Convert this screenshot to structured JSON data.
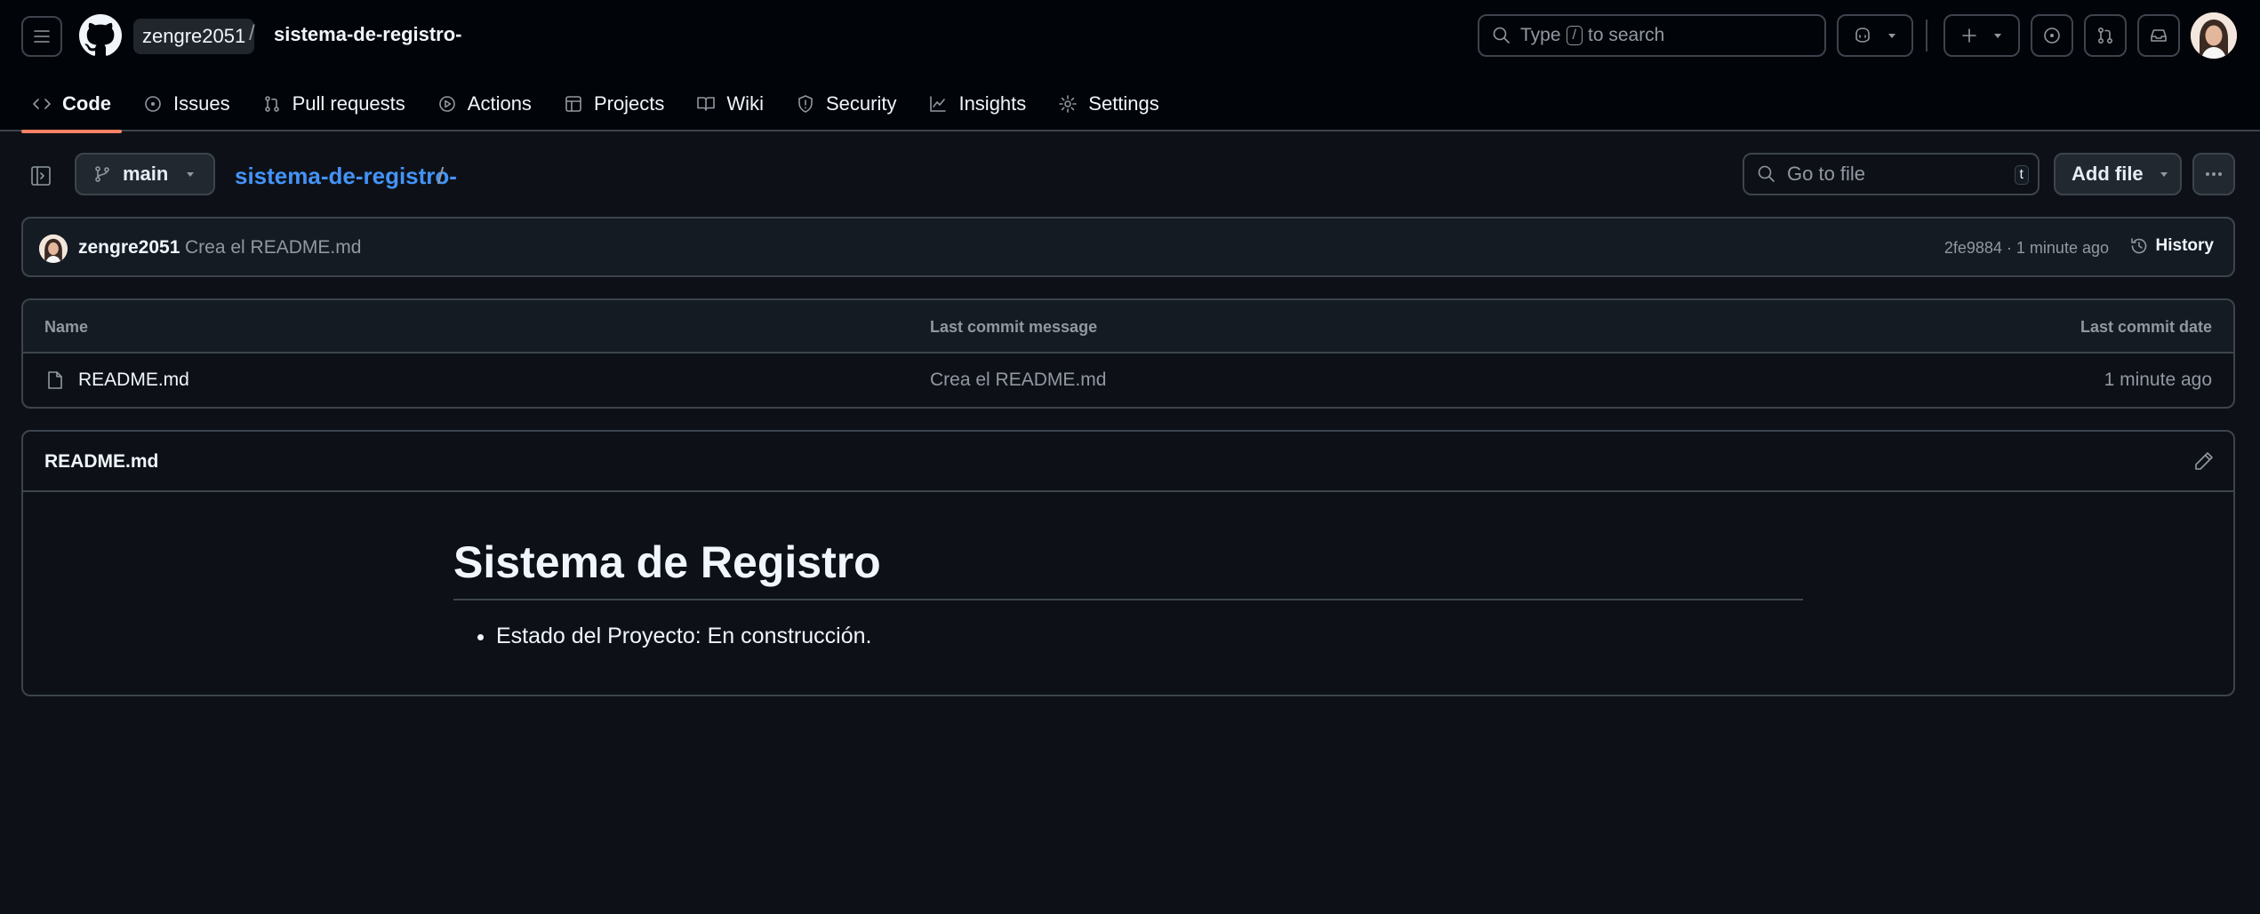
{
  "header": {
    "owner": "zengre2051",
    "separator": "/",
    "repo": "sistema-de-registro-",
    "search": {
      "prefix": "Type",
      "key": "/",
      "suffix": "to search"
    }
  },
  "nav": {
    "items": [
      {
        "label": "Code",
        "icon": "code-icon",
        "active": true
      },
      {
        "label": "Issues",
        "icon": "issue-icon"
      },
      {
        "label": "Pull requests",
        "icon": "pull-request-icon"
      },
      {
        "label": "Actions",
        "icon": "play-icon"
      },
      {
        "label": "Projects",
        "icon": "table-icon"
      },
      {
        "label": "Wiki",
        "icon": "book-icon"
      },
      {
        "label": "Security",
        "icon": "shield-icon"
      },
      {
        "label": "Insights",
        "icon": "graph-icon"
      },
      {
        "label": "Settings",
        "icon": "gear-icon"
      }
    ]
  },
  "toolbar": {
    "branch": "main",
    "breadcrumb_repo": "sistema-de-registro-",
    "breadcrumb_sep": "/",
    "goto_placeholder": "Go to file",
    "goto_key": "t",
    "add_file": "Add file"
  },
  "commit": {
    "author": "zengre2051",
    "message": "Crea el README.md",
    "meta": "2fe9884 · 1 minute ago",
    "history": "History"
  },
  "files": {
    "headers": {
      "name": "Name",
      "message": "Last commit message",
      "date": "Last commit date"
    },
    "rows": [
      {
        "name": "README.md",
        "message": "Crea el README.md",
        "date": "1 minute ago"
      }
    ]
  },
  "readme": {
    "title": "README.md",
    "heading": "Sistema de Registro",
    "items": [
      "Estado del Proyecto: En construcción."
    ]
  },
  "colors": {
    "bg": "#0d1117",
    "header": "#010409",
    "accent": "#f78166",
    "link": "#4493f8",
    "border": "#3d444d"
  }
}
